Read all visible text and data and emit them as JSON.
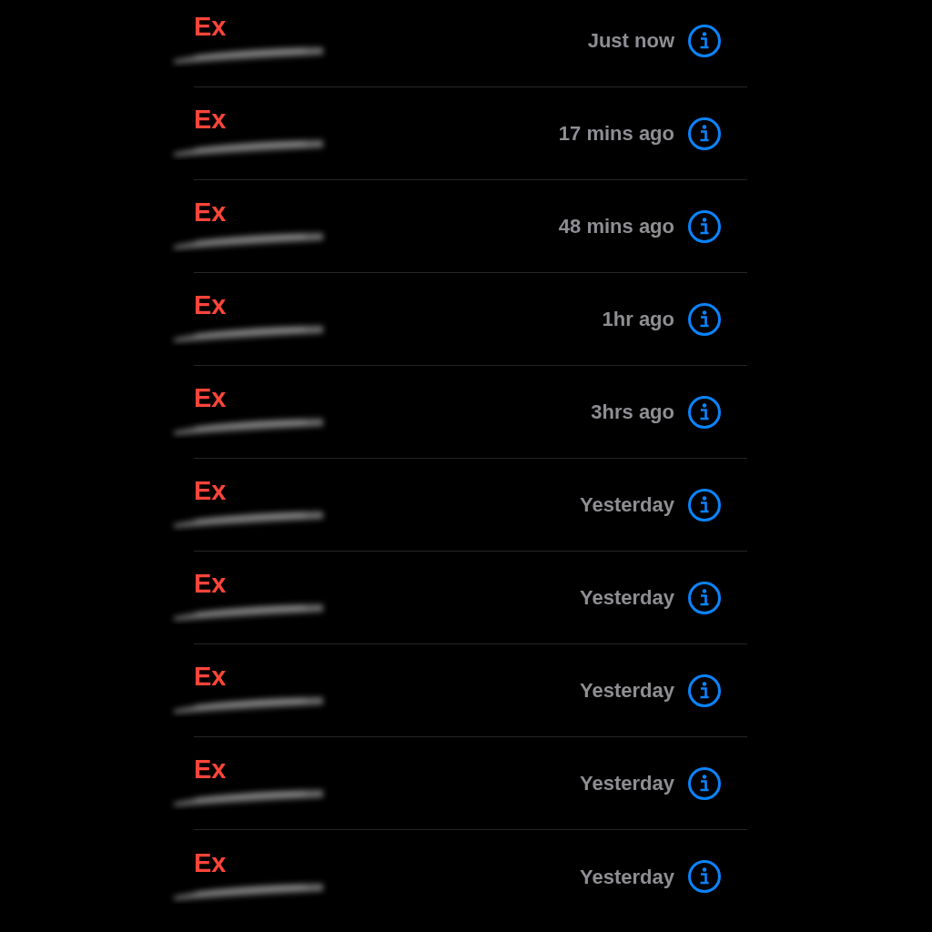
{
  "calls": [
    {
      "name": "Ex",
      "missed": true,
      "time": "Just now"
    },
    {
      "name": "Ex",
      "missed": true,
      "time": "17 mins ago"
    },
    {
      "name": "Ex",
      "missed": true,
      "time": "48 mins ago"
    },
    {
      "name": "Ex",
      "missed": true,
      "time": "1hr ago"
    },
    {
      "name": "Ex",
      "missed": true,
      "time": "3hrs ago"
    },
    {
      "name": "Ex",
      "missed": true,
      "time": "Yesterday"
    },
    {
      "name": "Ex",
      "missed": true,
      "time": "Yesterday"
    },
    {
      "name": "Ex",
      "missed": true,
      "time": "Yesterday"
    },
    {
      "name": "Ex",
      "missed": true,
      "time": "Yesterday"
    },
    {
      "name": "Ex",
      "missed": true,
      "time": "Yesterday"
    }
  ]
}
